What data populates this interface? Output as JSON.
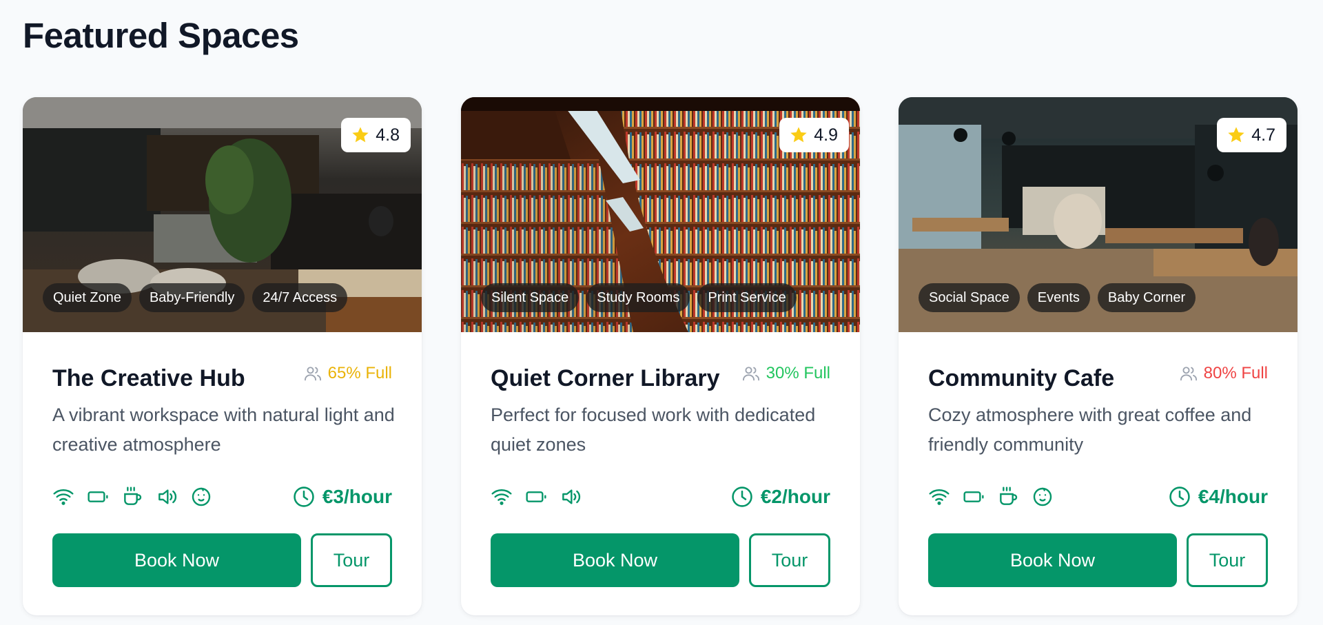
{
  "page": {
    "title": "Featured Spaces"
  },
  "colors": {
    "accent": "#059669",
    "occupancy_medium": "#eab308",
    "occupancy_low": "#22c55e",
    "occupancy_high": "#ef4444",
    "star": "#facc15"
  },
  "cards": [
    {
      "rating": "4.8",
      "tags": [
        "Quiet Zone",
        "Baby-Friendly",
        "24/7 Access"
      ],
      "name": "The Creative Hub",
      "occupancy": "65% Full",
      "occupancy_color": "#eab308",
      "description": "A vibrant workspace with natural light and creative atmosphere",
      "amenities": [
        "wifi-icon",
        "battery-icon",
        "coffee-icon",
        "speaker-icon",
        "baby-icon"
      ],
      "price": "€3/hour",
      "book_label": "Book Now",
      "tour_label": "Tour",
      "image": "cafe-interior-photo"
    },
    {
      "rating": "4.9",
      "tags": [
        "Silent Space",
        "Study Rooms",
        "Print Service"
      ],
      "name": "Quiet Corner Library",
      "occupancy": "30% Full",
      "occupancy_color": "#22c55e",
      "description": "Perfect for focused work with dedicated quiet zones",
      "amenities": [
        "wifi-icon",
        "battery-icon",
        "speaker-icon"
      ],
      "price": "€2/hour",
      "book_label": "Book Now",
      "tour_label": "Tour",
      "image": "library-bookshelves-photo"
    },
    {
      "rating": "4.7",
      "tags": [
        "Social Space",
        "Events",
        "Baby Corner"
      ],
      "name": "Community Cafe",
      "occupancy": "80% Full",
      "occupancy_color": "#ef4444",
      "description": "Cozy atmosphere with great coffee and friendly community",
      "amenities": [
        "wifi-icon",
        "battery-icon",
        "coffee-icon",
        "baby-icon"
      ],
      "price": "€4/hour",
      "book_label": "Book Now",
      "tour_label": "Tour",
      "image": "coffee-shop-photo"
    }
  ]
}
